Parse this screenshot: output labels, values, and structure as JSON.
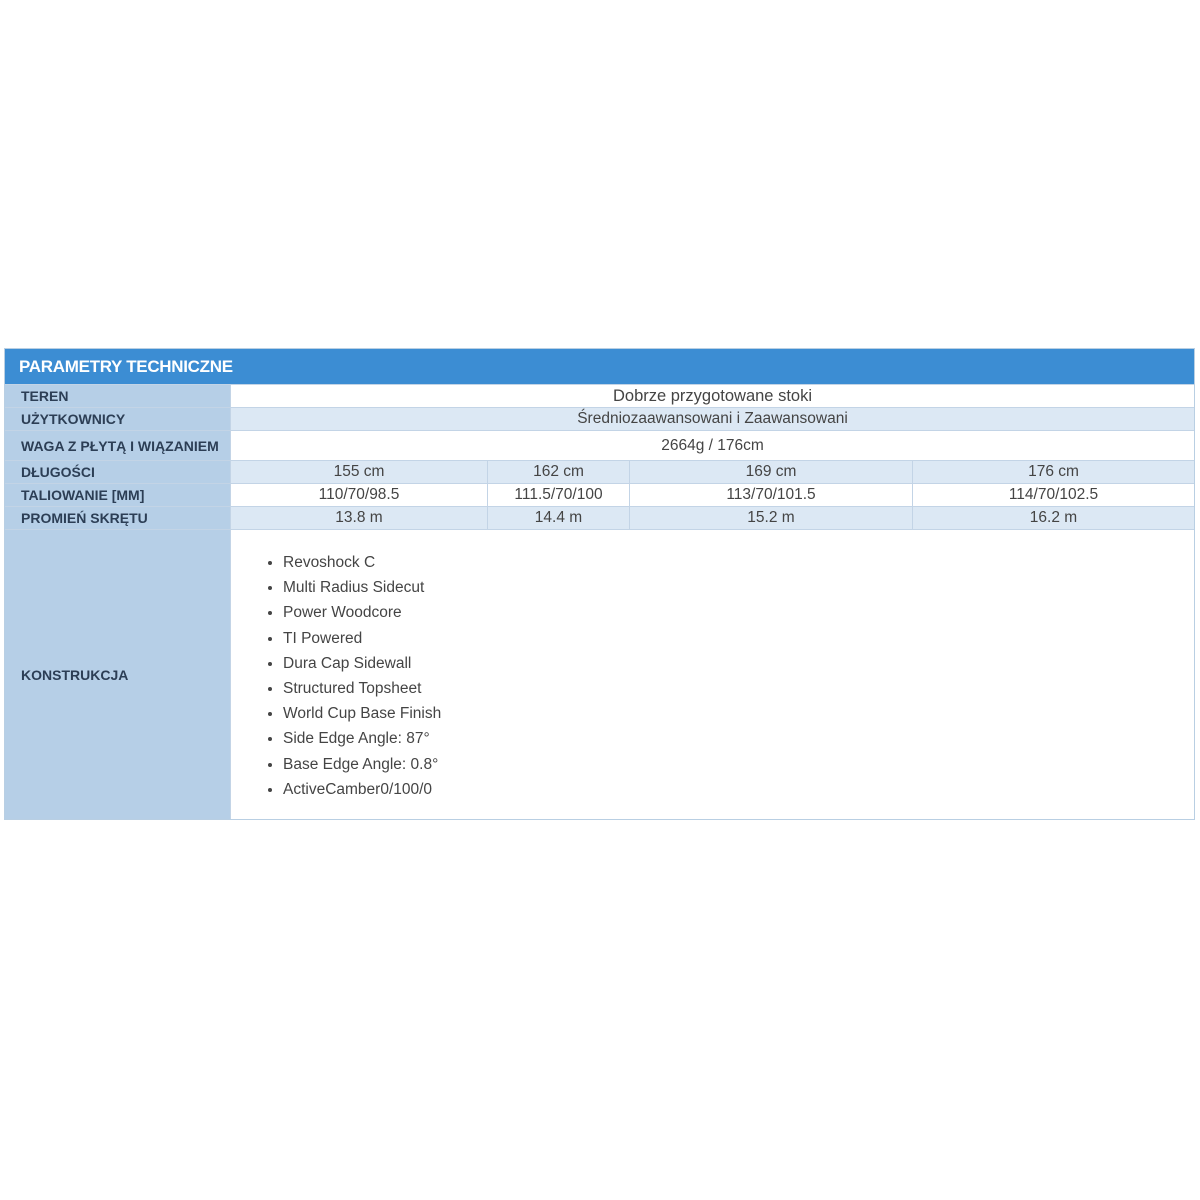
{
  "title": "PARAMETRY TECHNICZNE",
  "rows": {
    "teren": {
      "label": "TEREN",
      "value": "Dobrze przygotowane stoki"
    },
    "uzytkownicy": {
      "label": "UŻYTKOWNICY",
      "value": "Średniozaawansowani i Zaawansowani"
    },
    "waga": {
      "label": "WAGA Z PŁYTĄ I WIĄZANIEM",
      "value": "2664g / 176cm"
    },
    "dlugosci": {
      "label": "DŁUGOŚCI",
      "values": [
        "155 cm",
        "162 cm",
        "169 cm",
        "176 cm"
      ]
    },
    "taliowanie": {
      "label": "TALIOWANIE [MM]",
      "values": [
        "110/70/98.5",
        "111.5/70/100",
        "113/70/101.5",
        "114/70/102.5"
      ]
    },
    "promien": {
      "label": "PROMIEŃ SKRĘTU",
      "values": [
        "13.8 m",
        "14.4 m",
        "15.2 m",
        "16.2 m"
      ]
    },
    "konstrukcja": {
      "label": "KONSTRUKCJA",
      "items": [
        "Revoshock C",
        "Multi Radius Sidecut",
        "Power Woodcore",
        "TI Powered",
        "Dura Cap Sidewall",
        "Structured Topsheet",
        "World Cup Base Finish",
        "Side Edge Angle: 87°",
        "Base Edge Angle: 0.8°",
        "ActiveCamber0/100/0"
      ]
    }
  },
  "colors": {
    "header": "#3c8dd3",
    "label_bg": "#b6cfe7",
    "row_light": "#dce8f4"
  }
}
